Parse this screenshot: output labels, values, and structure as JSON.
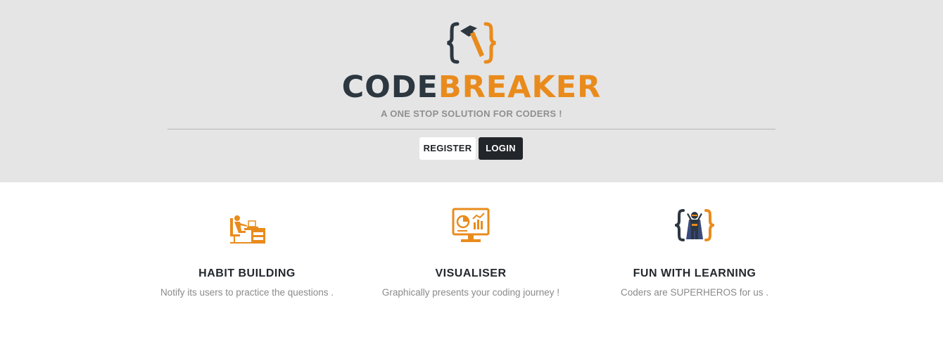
{
  "header": {
    "brand_part1": "CODE",
    "brand_part2": "BREAKER",
    "tagline": "A ONE STOP SOLUTION FOR CODERS !",
    "register_label": "REGISTER",
    "login_label": "LOGIN"
  },
  "features": [
    {
      "icon": "desk-worker-icon",
      "title": "HABIT BUILDING",
      "description": "Notify its users to practice the questions ."
    },
    {
      "icon": "monitor-chart-icon",
      "title": "VISUALISER",
      "description": "Graphically presents your coding journey !"
    },
    {
      "icon": "superhero-braces-icon",
      "title": "FUN WITH LEARNING",
      "description": "Coders are SUPERHEROS for us ."
    }
  ],
  "colors": {
    "accent": "#e98b1c",
    "dark": "#2c3740",
    "hero_bg": "#e5e5e5"
  }
}
